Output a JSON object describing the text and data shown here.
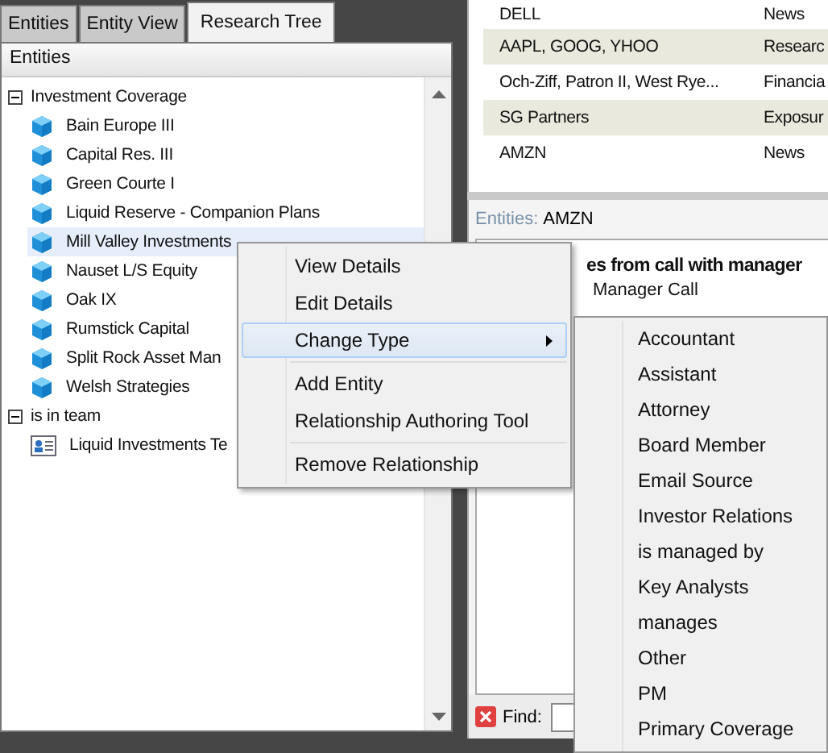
{
  "tabs": [
    {
      "label": "Entities",
      "selected": false
    },
    {
      "label": "Entity View",
      "selected": false
    },
    {
      "label": "Research Tree",
      "selected": true
    }
  ],
  "tree": {
    "header": "Entities",
    "nodes": [
      {
        "label": "Investment Coverage",
        "kind": "group",
        "expanded": true,
        "children": [
          {
            "label": "Bain Europe III",
            "kind": "entity",
            "selected": false
          },
          {
            "label": "Capital Res. III",
            "kind": "entity",
            "selected": false
          },
          {
            "label": "Green Courte I",
            "kind": "entity",
            "selected": false
          },
          {
            "label": "Liquid Reserve - Companion Plans",
            "kind": "entity",
            "selected": false
          },
          {
            "label": "Mill Valley Investments",
            "kind": "entity",
            "selected": true
          },
          {
            "label": "Nauset L/S Equity",
            "kind": "entity",
            "selected": false
          },
          {
            "label": "Oak IX",
            "kind": "entity",
            "selected": false
          },
          {
            "label": "Rumstick Capital",
            "kind": "entity",
            "selected": false
          },
          {
            "label": "Split Rock Asset Man",
            "kind": "entity",
            "selected": false
          },
          {
            "label": "Welsh Strategies",
            "kind": "entity",
            "selected": false
          }
        ]
      },
      {
        "label": "is in team",
        "kind": "group",
        "expanded": true,
        "children": [
          {
            "label": "Liquid Investments Te",
            "kind": "team",
            "selected": false
          }
        ]
      }
    ]
  },
  "table": {
    "rows": [
      {
        "column_1": "DELL",
        "column_2": "News"
      },
      {
        "column_1": "AAPL, GOOG, YHOO",
        "column_2": "Researc"
      },
      {
        "column_1": "Och-Ziff, Patron II, West Rye...",
        "column_2": "Financia"
      },
      {
        "column_1": "SG Partners",
        "column_2": "Exposur"
      },
      {
        "column_1": "AMZN",
        "column_2": "News"
      }
    ]
  },
  "detail": {
    "entities_label": "Entities:",
    "entities_value": "AMZN",
    "heading": "es from call with manager",
    "subheading": "Manager Call"
  },
  "find": {
    "label": "Find:"
  },
  "context_menu": {
    "items": [
      {
        "kind": "item",
        "label": "View Details",
        "selected": false,
        "submenu": false
      },
      {
        "kind": "item",
        "label": "Edit Details",
        "selected": false,
        "submenu": false
      },
      {
        "kind": "item",
        "label": "Change Type",
        "selected": true,
        "submenu": true
      },
      {
        "kind": "separator"
      },
      {
        "kind": "item",
        "label": "Add Entity",
        "selected": false,
        "submenu": false
      },
      {
        "kind": "item",
        "label": "Relationship Authoring Tool",
        "selected": false,
        "submenu": false
      },
      {
        "kind": "separator"
      },
      {
        "kind": "item",
        "label": "Remove Relationship",
        "selected": false,
        "submenu": false
      }
    ]
  },
  "submenu": {
    "items": [
      "Accountant",
      "Assistant",
      "Attorney",
      "Board Member",
      "Email Source",
      "Investor Relations",
      "is managed by",
      "Key Analysts",
      "manages",
      "Other",
      "PM",
      "Primary Coverage"
    ]
  }
}
